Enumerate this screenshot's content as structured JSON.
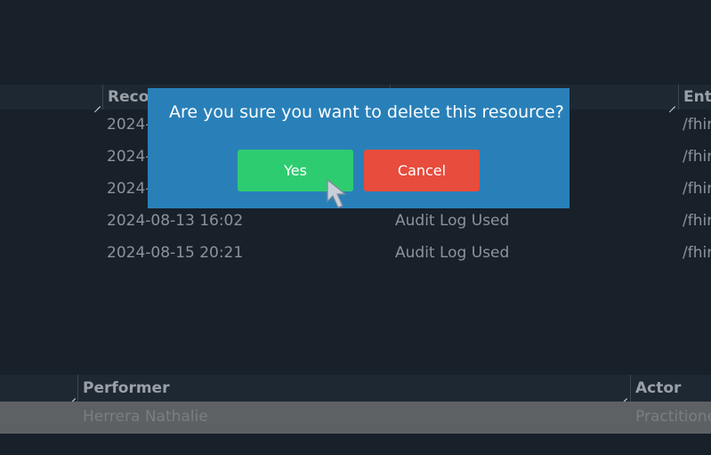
{
  "grid_top": {
    "headers": [
      "Recor",
      "Enti"
    ],
    "rows": [
      {
        "recorded": "2024-",
        "action": "",
        "entity": "/fhir"
      },
      {
        "recorded": "2024-",
        "action": "",
        "entity": "/fhir"
      },
      {
        "recorded": "2024-",
        "action": "",
        "entity": "/fhir"
      },
      {
        "recorded": "2024-08-13 16:02",
        "action": "Audit Log Used",
        "entity": "/fhir"
      },
      {
        "recorded": "2024-08-15 20:21",
        "action": "Audit Log Used",
        "entity": "/fhir"
      }
    ]
  },
  "grid_bottom": {
    "headers": [
      "Performer",
      "Actor"
    ],
    "row": {
      "performer": "Herrera Nathalie",
      "actor": "Practitione"
    }
  },
  "dialog": {
    "message": "Are you sure you want to delete this resource?",
    "yes_label": "Yes",
    "cancel_label": "Cancel",
    "yes_color": "#2ecc71",
    "cancel_color": "#e74c3c",
    "background_color": "#2980b9"
  }
}
